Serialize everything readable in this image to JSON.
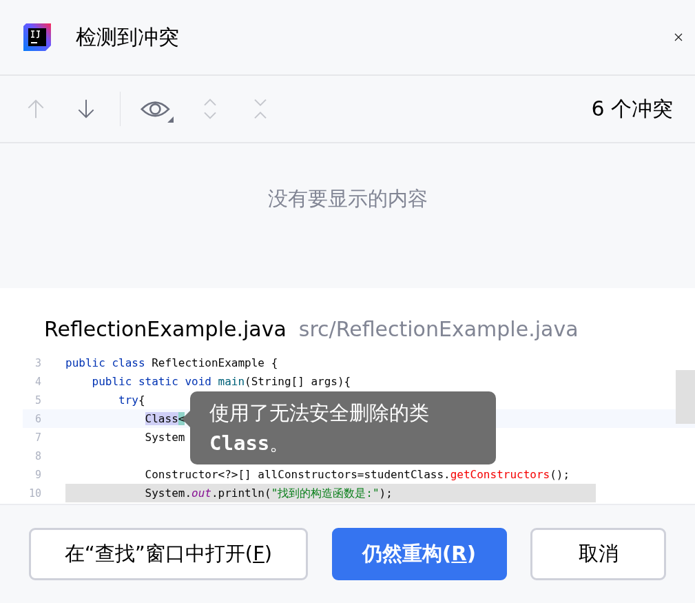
{
  "window": {
    "title": "检测到冲突"
  },
  "toolbar": {
    "items": [
      {
        "kind": "up",
        "disabled": true
      },
      {
        "kind": "down",
        "disabled": false
      },
      {
        "kind": "separator"
      },
      {
        "kind": "eye",
        "disabled": false
      },
      {
        "kind": "expand",
        "disabled": true
      },
      {
        "kind": "collapse",
        "disabled": true
      }
    ],
    "count": "6 个冲突"
  },
  "conflicts": {
    "empty_text": "没有要显示的内容"
  },
  "preview": {
    "file_name": "ReflectionExample.java",
    "file_path": "src/ReflectionExample.java",
    "lines": [
      {
        "number": "3",
        "current": false,
        "grey": false,
        "segments": [
          {
            "kind": "kw",
            "text": "public class "
          },
          {
            "kind": "plain",
            "text": "ReflectionExample {"
          }
        ]
      },
      {
        "number": "4",
        "current": false,
        "grey": false,
        "segments": [
          {
            "kind": "kw",
            "text": "    public static void "
          },
          {
            "kind": "fn",
            "text": "main"
          },
          {
            "kind": "plain",
            "text": "(String[] args){"
          }
        ]
      },
      {
        "number": "5",
        "current": false,
        "grey": false,
        "segments": [
          {
            "kind": "kw",
            "text": "        try"
          },
          {
            "kind": "plain",
            "text": "{"
          }
        ]
      },
      {
        "number": "6",
        "current": true,
        "grey": false,
        "segments": [
          {
            "kind": "hl",
            "text": "            Class"
          },
          {
            "kind": "mark",
            "text": "<"
          }
        ]
      },
      {
        "number": "7",
        "current": false,
        "grey": false,
        "segments": [
          {
            "kind": "plain",
            "text": "            System"
          }
        ]
      },
      {
        "number": "8",
        "current": false,
        "grey": false
      },
      {
        "number": "9",
        "current": false,
        "grey": false,
        "segments": [
          {
            "kind": "plain",
            "text": "            Constructor<?>[] allConstructors=studentClass."
          },
          {
            "kind": "err",
            "text": "getConstructors"
          },
          {
            "kind": "plain",
            "text": "();"
          }
        ]
      },
      {
        "number": "10",
        "current": false,
        "grey": true,
        "segments": [
          {
            "kind": "plain",
            "text": "            System."
          },
          {
            "kind": "field",
            "text": "out"
          },
          {
            "kind": "plain",
            "text": ".println("
          },
          {
            "kind": "str",
            "text": "\"找到的构造函数是:\""
          },
          {
            "kind": "plain",
            "text": ");"
          }
        ]
      }
    ],
    "tooltip": "使用了无法安全删除的类 **Class**。"
  },
  "buttons": [
    {
      "kind": "secondary",
      "label": "在“查找”窗口中打开(",
      "mnemonic": "F",
      "label_end": ")"
    },
    {
      "kind": "primary",
      "label": "仍然重构(",
      "mnemonic": "R",
      "label_end": ")"
    },
    {
      "kind": "secondary",
      "label": "取消"
    }
  ]
}
